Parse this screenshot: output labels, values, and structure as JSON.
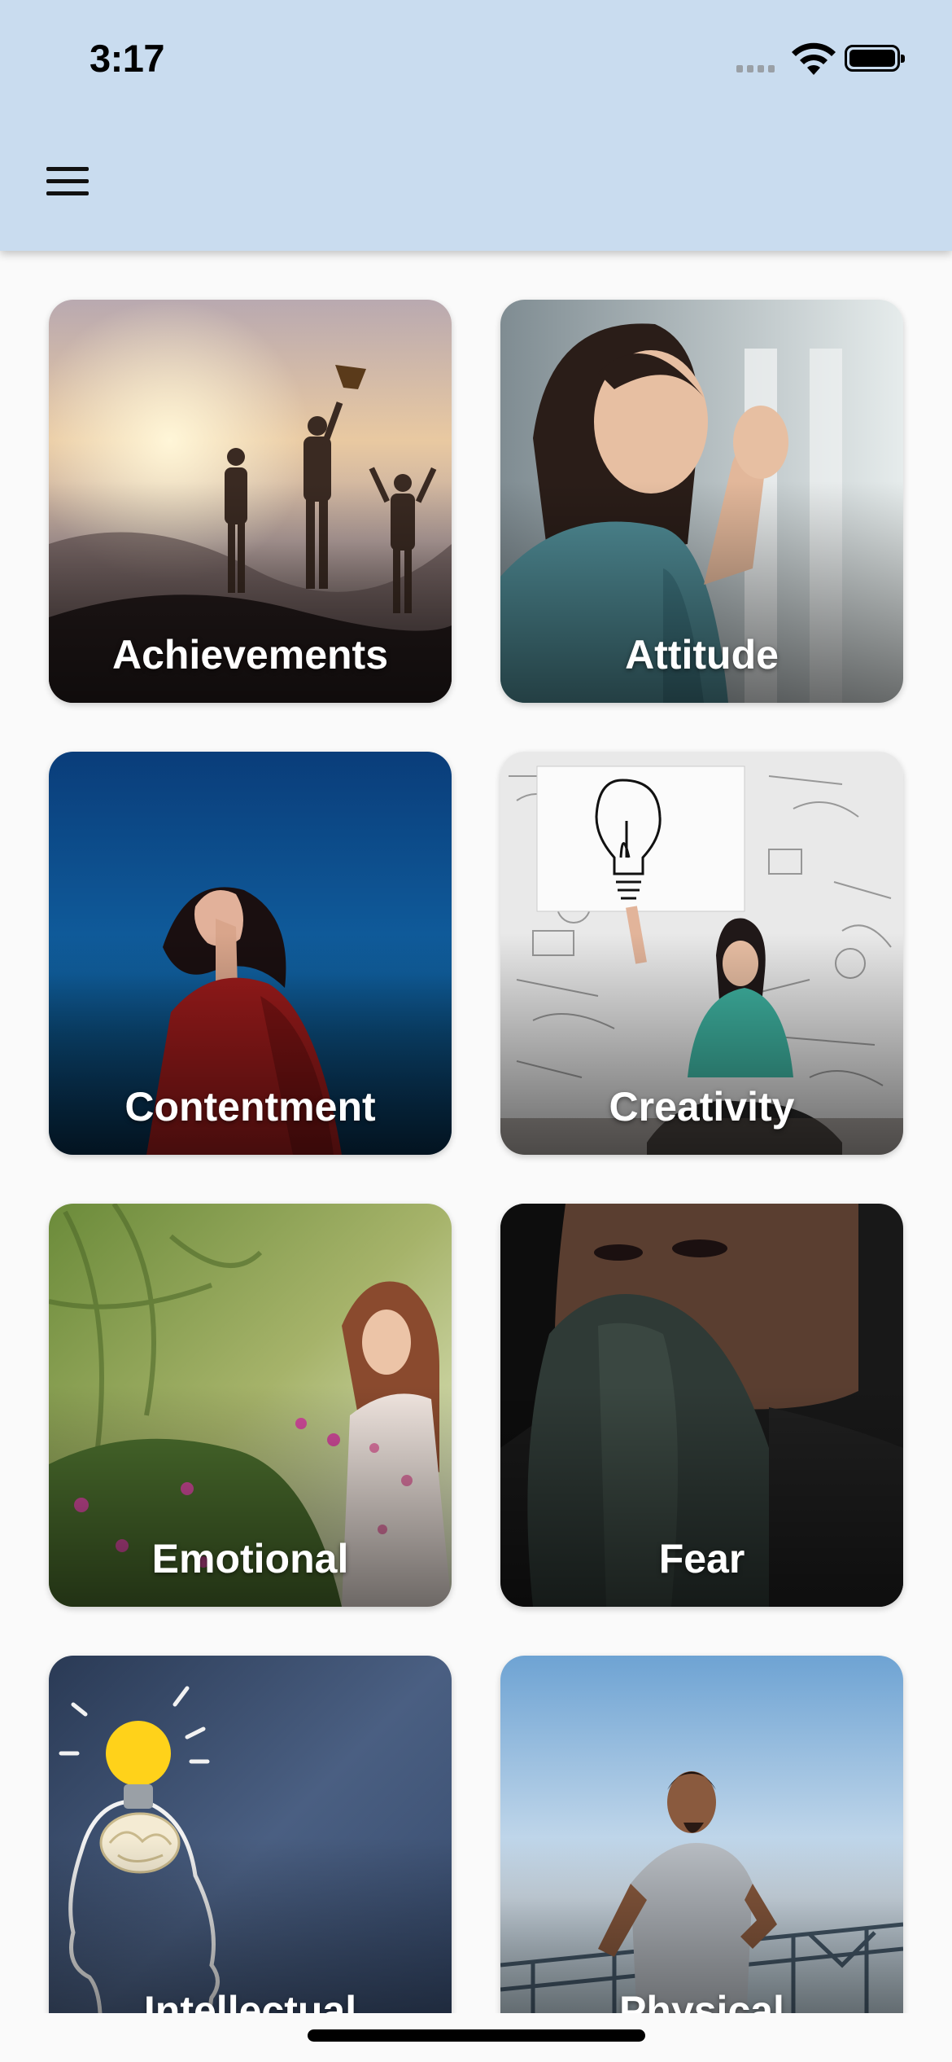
{
  "status_bar": {
    "time": "3:17",
    "icons": [
      "cellular-signal-icon",
      "wifi-icon",
      "battery-icon"
    ]
  },
  "header": {
    "menu_icon": "hamburger-menu-icon",
    "background_color": "#c9dcef"
  },
  "categories": [
    {
      "label": "Achievements",
      "image": "silhouettes celebrating on a mountain at sunset with a trophy"
    },
    {
      "label": "Attitude",
      "image": "smiling woman waving"
    },
    {
      "label": "Contentment",
      "image": "woman in red looking up at a blue sky"
    },
    {
      "label": "Creativity",
      "image": "woman holding a light bulb sign in front of a sketched wall"
    },
    {
      "label": "Emotional",
      "image": "woman touching flowers in a garden"
    },
    {
      "label": "Fear",
      "image": "woman covering her face with her sleeve"
    },
    {
      "label": "Intellectual",
      "image": "chalk drawing of a head with a light bulb"
    },
    {
      "label": "Physical",
      "image": "man jogging outdoors"
    }
  ]
}
